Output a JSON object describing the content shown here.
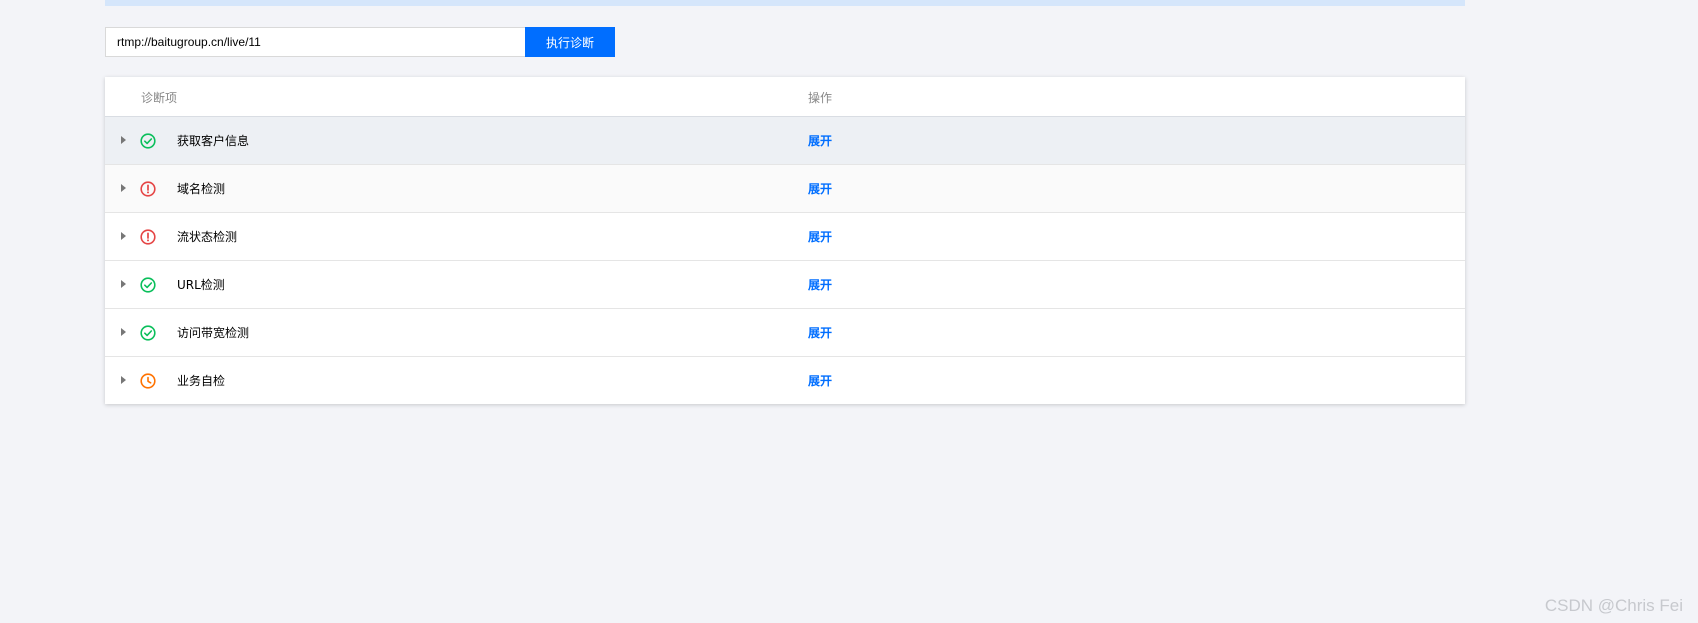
{
  "form": {
    "url_value": "rtmp://baitugroup.cn/live/11",
    "run_label": "执行诊断"
  },
  "table": {
    "headers": {
      "item": "诊断项",
      "operation": "操作"
    },
    "rows": [
      {
        "label": "获取客户信息",
        "status": "success",
        "action": "展开"
      },
      {
        "label": "域名检测",
        "status": "error",
        "action": "展开"
      },
      {
        "label": "流状态检测",
        "status": "error",
        "action": "展开"
      },
      {
        "label": "URL检测",
        "status": "success",
        "action": "展开"
      },
      {
        "label": "访问带宽检测",
        "status": "success",
        "action": "展开"
      },
      {
        "label": "业务自检",
        "status": "pending",
        "action": "展开"
      }
    ]
  },
  "colors": {
    "accent": "#006eff",
    "success": "#0abf5b",
    "error": "#e54545",
    "pending": "#ff7200"
  },
  "watermark": "CSDN @Chris Fei"
}
